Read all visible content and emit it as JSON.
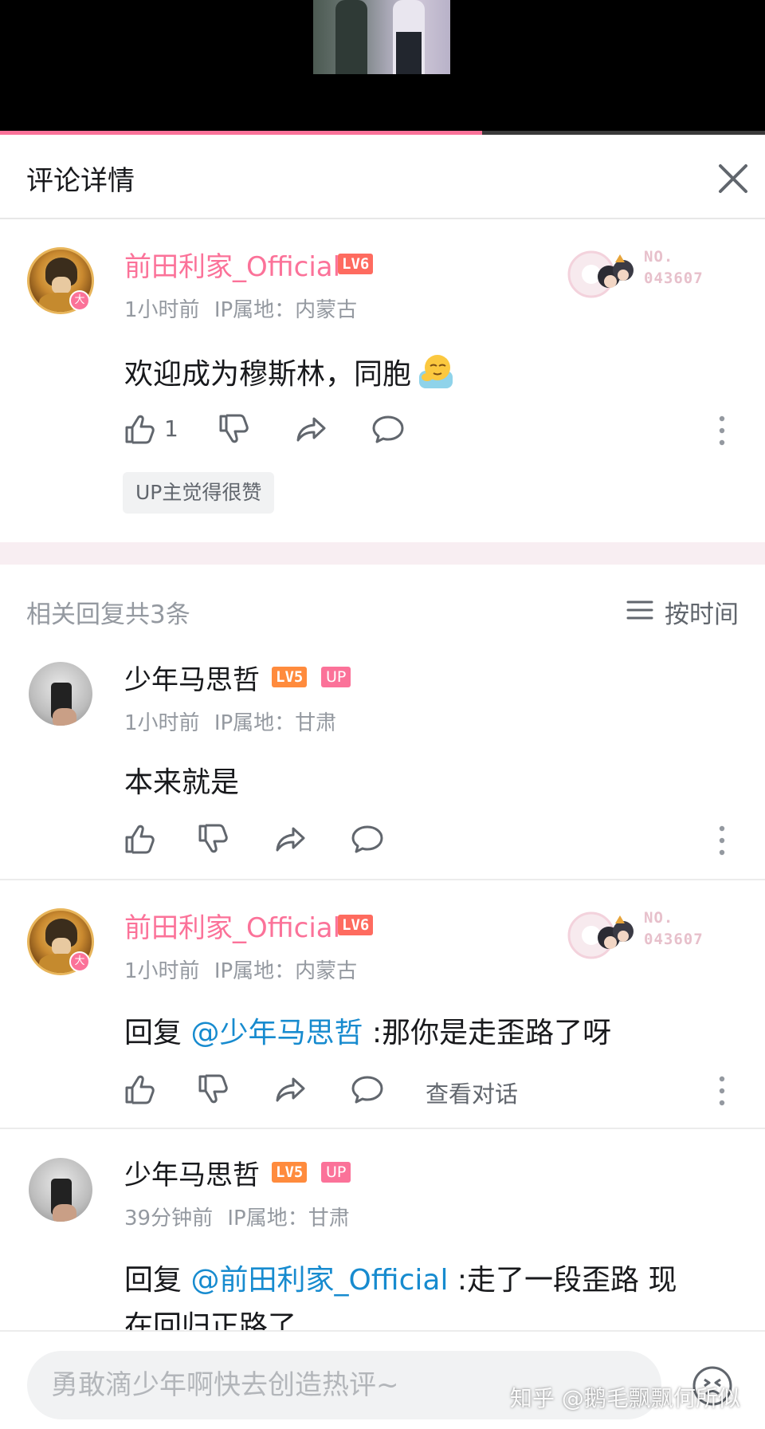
{
  "header": {
    "title": "评论详情"
  },
  "main_comment": {
    "username": "前田利家_Official",
    "level": "LV6",
    "vip_badge": "大",
    "time": "1小时前",
    "ip_label": "IP属地：",
    "ip": "内蒙古",
    "text": "欢迎成为穆斯林，同胞",
    "fan_no_label": "NO.",
    "fan_no": "043607",
    "likes": "1",
    "chip": "UP主觉得很赞"
  },
  "replies_section": {
    "title": "相关回复共3条",
    "sort_label": "按时间"
  },
  "replies": [
    {
      "username": "少年马思哲",
      "level": "LV5",
      "up_tag": "UP",
      "time": "1小时前",
      "ip_label": "IP属地：",
      "ip": "甘肃",
      "text": "本来就是"
    },
    {
      "username": "前田利家_Official",
      "level": "LV6",
      "vip_badge": "大",
      "time": "1小时前",
      "ip_label": "IP属地：",
      "ip": "内蒙古",
      "reply_prefix": "回复",
      "mention": "@少年马思哲",
      "text": ":那你是走歪路了呀",
      "fan_no_label": "NO.",
      "fan_no": "043607",
      "view_conversation": "查看对话"
    },
    {
      "username": "少年马思哲",
      "level": "LV5",
      "up_tag": "UP",
      "time": "39分钟前",
      "ip_label": "IP属地：",
      "ip": "甘肃",
      "reply_prefix": "回复",
      "mention": "@前田利家_Official",
      "text": ":走了一段歪路 现",
      "text_line2": "在回归正路了"
    }
  ],
  "input": {
    "placeholder": "勇敢滴少年啊快去创造热评~"
  },
  "watermark": "知乎 @鹅毛飘飘何所似",
  "colors": {
    "accent": "#fb7299",
    "mention": "#178bcf",
    "level6": "#fe6b5f",
    "level5": "#ff8b3d"
  },
  "icons": [
    "close-icon",
    "thumbs-up-icon",
    "thumbs-down-icon",
    "share-icon",
    "comment-icon",
    "more-vertical-icon",
    "sort-list-icon",
    "emoji-icon"
  ],
  "video": {
    "progress": 0.63
  }
}
